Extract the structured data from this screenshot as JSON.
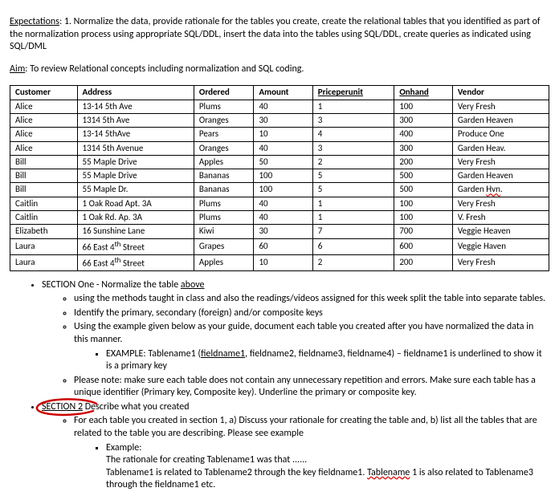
{
  "expectations_label": "Expectations",
  "expectations_text": ": 1. Normalize the data, provide rationale for the tables you create, create the relational tables that you identified as part of the normalization process using appropriate SQL/DDL, insert the data into the tables using SQL/DDL, create queries as indicated using SQL/DML",
  "aim_label": "Aim",
  "aim_text": ": To review Relational concepts including normalization and SQL coding.",
  "headers": [
    "Customer",
    "Address",
    "Ordered",
    "Amount",
    "Priceperunit",
    "Onhand",
    "Vendor"
  ],
  "rows": [
    [
      "Alice",
      "13-14 5th Ave",
      "Plums",
      "40",
      "1",
      "100",
      "Very Fresh"
    ],
    [
      "Alice",
      "1314 5th Ave",
      "Oranges",
      "30",
      "3",
      "300",
      "Garden Heaven"
    ],
    [
      "Alice",
      "13-14 5thAve",
      "Pears",
      "10",
      "4",
      "400",
      "Produce One"
    ],
    [
      "Alice",
      "1314 5th Avenue",
      "Oranges",
      "40",
      "3",
      "300",
      "Garden Heav."
    ],
    [
      "Bill",
      "55 Maple Drive",
      "Apples",
      "50",
      "2",
      "200",
      "Very Fresh"
    ],
    [
      "Bill",
      "55 Maple Drive",
      "Bananas",
      "100",
      "5",
      "500",
      "Garden Heaven"
    ],
    [
      "Bill",
      "55 Maple Dr.",
      "Bananas",
      "100",
      "5",
      "500",
      "Garden Hvn."
    ],
    [
      "Caitlin",
      "1 Oak Road Apt. 3A",
      "Plums",
      "40",
      "1",
      "100",
      "Very Fresh"
    ],
    [
      "Caitlin",
      "1 Oak Rd. Ap. 3A",
      "Plums",
      "40",
      "1",
      "100",
      "V. Fresh"
    ],
    [
      "Elizabeth",
      "16 Sunshine Lane",
      "Kiwi",
      "30",
      "7",
      "700",
      "Veggie Heaven"
    ],
    [
      "Laura",
      "66 East 4th Street",
      "Grapes",
      "60",
      "6",
      "600",
      "Veggie Haven"
    ],
    [
      "Laura",
      "66 East 4th Street",
      "Apples",
      "10",
      "2",
      "200",
      "Very Fresh"
    ]
  ],
  "sec1_title": "SECTION One - Normalize the table ",
  "sec1_title_u": "above",
  "sec1_b1": "using the methods taught in class and also the readings/videos assigned for this week split the table into separate tables.",
  "sec1_b2": "Identify the primary, secondary (foreign) and/or composite keys",
  "sec1_b3": "Using the example given below as your guide, document each table you created after you have normalized the data in this manner.",
  "sec1_b3_ex_a": "EXAMPLE: Tablename1 (",
  "sec1_b3_ex_b": "fieldname1",
  "sec1_b3_ex_c": ", fieldname2, fieldname3, fieldname4) – fieldname1 is underlined to show it is a primary key",
  "sec1_b4": "Please note: make sure each table does not contain any unnecessary repetition and errors. Make sure each table has a unique identifier (Primary key, Composite key). Underline the primary or composite key.",
  "sec2_label": "SECTION 2",
  "sec2_tail": " Describe what you created",
  "sec2_b1": "For each table you created in section 1, a) Discuss your rationale for creating the table and, b) list all the tables that are related to the table you are describing. Please see example",
  "sec2_ex_label": "Example:",
  "sec2_ex_l1": "The rationale for creating Tablename1 was that ......",
  "sec2_ex_l2a": "Tablename1 is related to Tablename2 through the key fieldname1. ",
  "sec2_ex_l2b": "Tablename",
  "sec2_ex_l2c": " 1 is also related to Tablename3 through the fieldname1 etc."
}
